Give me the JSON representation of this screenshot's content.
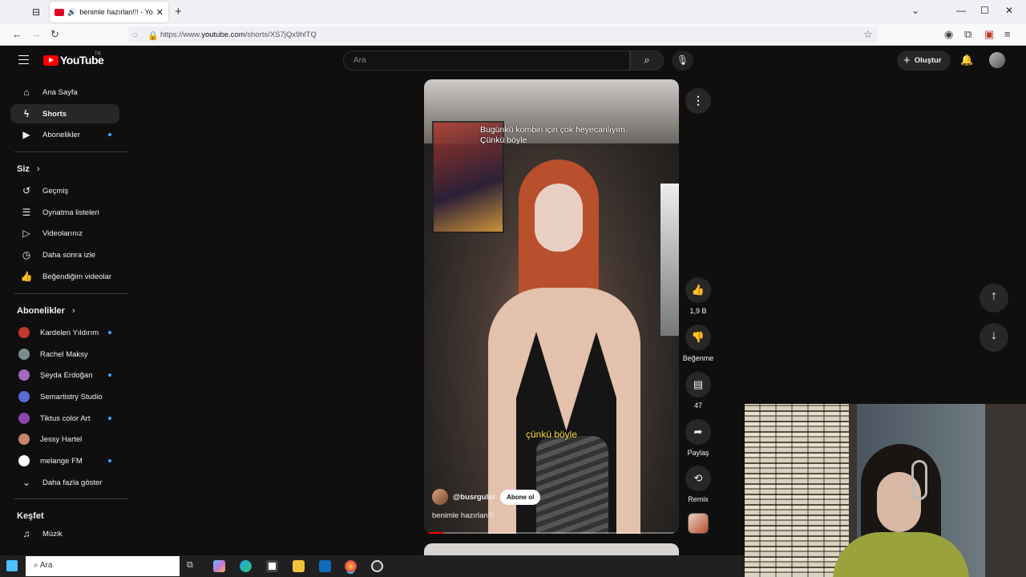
{
  "browser": {
    "tab_title": "benimle hazırlan!!! - YouTube",
    "url_prefix": "https://www.",
    "url_domain": "youtube.com",
    "url_path": "/shorts/XS7jQx9hlTQ"
  },
  "header": {
    "logo": "YouTube",
    "region": "TR",
    "search_placeholder": "Ara",
    "create_label": "Oluştur"
  },
  "sidebar": {
    "main": [
      {
        "label": "Ana Sayfa",
        "icon": "home-icon"
      },
      {
        "label": "Shorts",
        "icon": "shorts-icon"
      },
      {
        "label": "Abonelikler",
        "icon": "subscriptions-icon"
      }
    ],
    "you_title": "Siz",
    "you_items": [
      {
        "label": "Geçmiş",
        "icon": "history-icon"
      },
      {
        "label": "Oynatma listeleri",
        "icon": "playlists-icon"
      },
      {
        "label": "Videolarınız",
        "icon": "your-videos-icon"
      },
      {
        "label": "Daha sonra izle",
        "icon": "watch-later-icon"
      },
      {
        "label": "Beğendiğim videolar",
        "icon": "liked-icon"
      }
    ],
    "subs_title": "Abonelikler",
    "subs": [
      {
        "label": "Kardelen Yıldırım",
        "color": "#c0392b"
      },
      {
        "label": "Rachel Maksy",
        "color": "#7f8c8d"
      },
      {
        "label": "Şeyda Erdoğan",
        "color": "#a569bd"
      },
      {
        "label": "Semartistry Studio",
        "color": "#5b6bd6"
      },
      {
        "label": "Tiktus color Art",
        "color": "#8e44ad"
      },
      {
        "label": "Jessy Hartel",
        "color": "#c9856b"
      },
      {
        "label": "melange FM",
        "color": "#ffffff"
      }
    ],
    "show_more": "Daha fazla göster",
    "explore_title": "Keşfet",
    "explore_items": [
      {
        "label": "Müzik",
        "icon": "music-icon"
      }
    ]
  },
  "video": {
    "caption_top_1": "Bugünkü kombin için çok heyecanlıyım.",
    "caption_top_2": "Çünkü böyle",
    "caption_mid": "çünkü böyle",
    "channel": "@busrguler",
    "subscribe_label": "Abone ol",
    "title": "benimle hazırlan!!!",
    "progress": 0.06
  },
  "actions": {
    "likes": "1,9 B",
    "dislike_label": "Beğenme",
    "comments": "47",
    "share_label": "Paylaş",
    "remix_label": "Remix"
  },
  "taskbar": {
    "search_text": "Ara",
    "apps": [
      "task-view-icon",
      "copilot-icon",
      "edge-icon",
      "store-icon",
      "file-explorer-icon",
      "outlook-icon",
      "firefox-icon",
      "obs-icon"
    ]
  }
}
